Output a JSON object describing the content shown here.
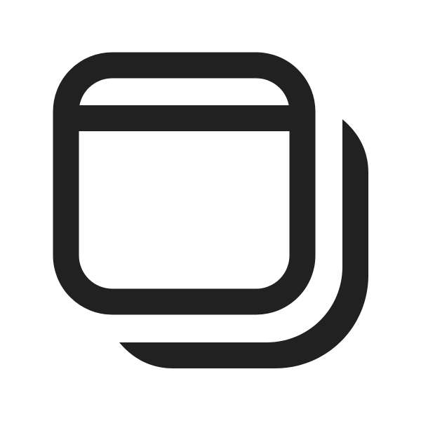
{
  "icon": {
    "name": "window-multiple-icon",
    "stroke_color": "#212121",
    "background_color": "#ffffff"
  }
}
